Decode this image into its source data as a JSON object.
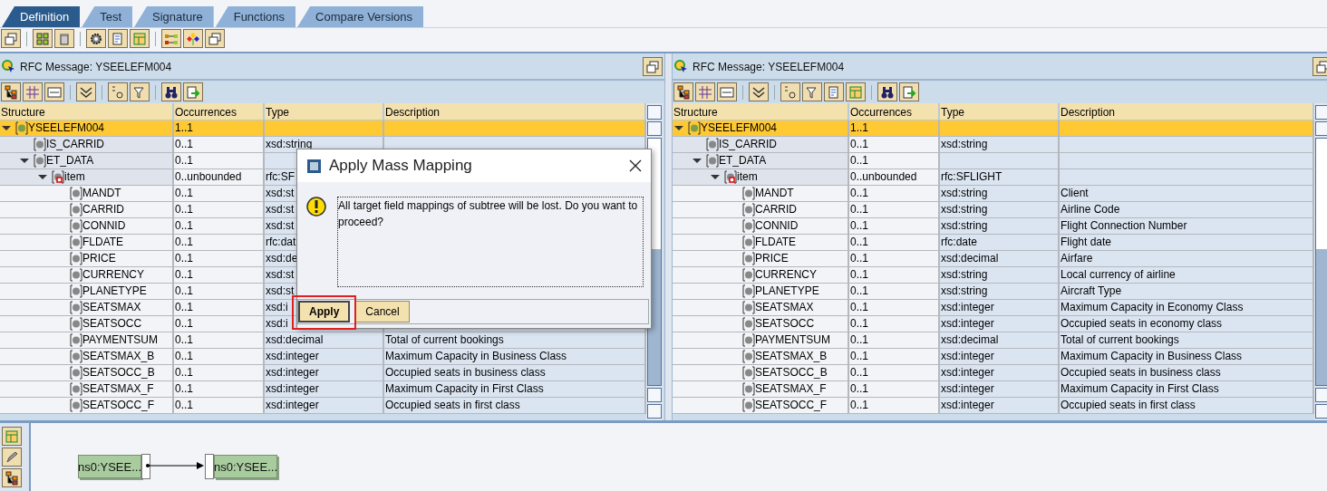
{
  "tabs": [
    {
      "label": "Definition",
      "selected": true
    },
    {
      "label": "Test",
      "selected": false
    },
    {
      "label": "Signature",
      "selected": false
    },
    {
      "label": "Functions",
      "selected": false
    },
    {
      "label": "Compare Versions",
      "selected": false
    }
  ],
  "panels": [
    {
      "title": "RFC Message: YSEELEFM004",
      "columns": [
        "Structure",
        "Occurrences",
        "Type",
        "Description"
      ],
      "tree": [
        {
          "name": "YSEELEFM004",
          "kind": "root",
          "occurrences": "1..1",
          "selected": true,
          "expanded": true,
          "children": [
            {
              "name": "IS_CARRID",
              "kind": "field",
              "occurrences": "0..1",
              "type": "xsd:string",
              "selected": false
            },
            {
              "name": "ET_DATA",
              "kind": "field",
              "occurrences": "0..1",
              "selected": false,
              "expanded": true,
              "children": [
                {
                  "name": "item",
                  "kind": "table",
                  "occurrences": "0..unbounded",
                  "type": "rfc:SF",
                  "selected": false,
                  "expanded": true,
                  "children": [
                    {
                      "name": "MANDT",
                      "kind": "field",
                      "occurrences": "0..1",
                      "type": "xsd:st",
                      "selected": false
                    },
                    {
                      "name": "CARRID",
                      "kind": "field",
                      "occurrences": "0..1",
                      "type": "xsd:st",
                      "selected": false
                    },
                    {
                      "name": "CONNID",
                      "kind": "field",
                      "occurrences": "0..1",
                      "type": "xsd:st",
                      "selected": false
                    },
                    {
                      "name": "FLDATE",
                      "kind": "field",
                      "occurrences": "0..1",
                      "type": "rfc:dat",
                      "selected": false
                    },
                    {
                      "name": "PRICE",
                      "kind": "field",
                      "occurrences": "0..1",
                      "type": "xsd:de",
                      "selected": false
                    },
                    {
                      "name": "CURRENCY",
                      "kind": "field",
                      "occurrences": "0..1",
                      "type": "xsd:st",
                      "selected": false
                    },
                    {
                      "name": "PLANETYPE",
                      "kind": "field",
                      "occurrences": "0..1",
                      "type": "xsd:st",
                      "selected": false
                    },
                    {
                      "name": "SEATSMAX",
                      "kind": "field",
                      "occurrences": "0..1",
                      "type": "xsd:i",
                      "selected": false
                    },
                    {
                      "name": "SEATSOCC",
                      "kind": "field",
                      "occurrences": "0..1",
                      "type": "xsd:i",
                      "selected": false
                    },
                    {
                      "name": "PAYMENTSUM",
                      "kind": "field",
                      "occurrences": "0..1",
                      "type": "xsd:decimal",
                      "description": "Total of current bookings",
                      "selected": false
                    },
                    {
                      "name": "SEATSMAX_B",
                      "kind": "field",
                      "occurrences": "0..1",
                      "type": "xsd:integer",
                      "description": "Maximum Capacity in Business Class",
                      "selected": false
                    },
                    {
                      "name": "SEATSOCC_B",
                      "kind": "field",
                      "occurrences": "0..1",
                      "type": "xsd:integer",
                      "description": "Occupied seats in business class",
                      "selected": false
                    },
                    {
                      "name": "SEATSMAX_F",
                      "kind": "field",
                      "occurrences": "0..1",
                      "type": "xsd:integer",
                      "description": "Maximum Capacity in First Class",
                      "selected": false
                    },
                    {
                      "name": "SEATSOCC_F",
                      "kind": "field",
                      "occurrences": "0..1",
                      "type": "xsd:integer",
                      "description": "Occupied seats in first class",
                      "selected": false
                    }
                  ]
                }
              ]
            }
          ]
        }
      ]
    },
    {
      "title": "RFC Message: YSEELEFM004",
      "columns": [
        "Structure",
        "Occurrences",
        "Type",
        "Description"
      ],
      "tree": [
        {
          "name": "YSEELEFM004",
          "kind": "root",
          "occurrences": "1..1",
          "selected": true,
          "expanded": true,
          "children": [
            {
              "name": "IS_CARRID",
              "kind": "field",
              "occurrences": "0..1",
              "type": "xsd:string",
              "selected": false
            },
            {
              "name": "ET_DATA",
              "kind": "field",
              "occurrences": "0..1",
              "selected": false,
              "expanded": true,
              "children": [
                {
                  "name": "item",
                  "kind": "table",
                  "occurrences": "0..unbounded",
                  "type": "rfc:SFLIGHT",
                  "selected": false,
                  "expanded": true,
                  "children": [
                    {
                      "name": "MANDT",
                      "kind": "field",
                      "occurrences": "0..1",
                      "type": "xsd:string",
                      "description": "Client",
                      "selected": false
                    },
                    {
                      "name": "CARRID",
                      "kind": "field",
                      "occurrences": "0..1",
                      "type": "xsd:string",
                      "description": "Airline Code",
                      "selected": false
                    },
                    {
                      "name": "CONNID",
                      "kind": "field",
                      "occurrences": "0..1",
                      "type": "xsd:string",
                      "description": "Flight Connection Number",
                      "selected": false
                    },
                    {
                      "name": "FLDATE",
                      "kind": "field",
                      "occurrences": "0..1",
                      "type": "rfc:date",
                      "description": "Flight date",
                      "selected": false
                    },
                    {
                      "name": "PRICE",
                      "kind": "field",
                      "occurrences": "0..1",
                      "type": "xsd:decimal",
                      "description": "Airfare",
                      "selected": false
                    },
                    {
                      "name": "CURRENCY",
                      "kind": "field",
                      "occurrences": "0..1",
                      "type": "xsd:string",
                      "description": "Local currency of airline",
                      "selected": false
                    },
                    {
                      "name": "PLANETYPE",
                      "kind": "field",
                      "occurrences": "0..1",
                      "type": "xsd:string",
                      "description": "Aircraft Type",
                      "selected": false
                    },
                    {
                      "name": "SEATSMAX",
                      "kind": "field",
                      "occurrences": "0..1",
                      "type": "xsd:integer",
                      "description": "Maximum Capacity in Economy Class",
                      "selected": false
                    },
                    {
                      "name": "SEATSOCC",
                      "kind": "field",
                      "occurrences": "0..1",
                      "type": "xsd:integer",
                      "description": "Occupied seats in economy class",
                      "selected": false
                    },
                    {
                      "name": "PAYMENTSUM",
                      "kind": "field",
                      "occurrences": "0..1",
                      "type": "xsd:decimal",
                      "description": "Total of current bookings",
                      "selected": false
                    },
                    {
                      "name": "SEATSMAX_B",
                      "kind": "field",
                      "occurrences": "0..1",
                      "type": "xsd:integer",
                      "description": "Maximum Capacity in Business Class",
                      "selected": false
                    },
                    {
                      "name": "SEATSOCC_B",
                      "kind": "field",
                      "occurrences": "0..1",
                      "type": "xsd:integer",
                      "description": "Occupied seats in business class",
                      "selected": false
                    },
                    {
                      "name": "SEATSMAX_F",
                      "kind": "field",
                      "occurrences": "0..1",
                      "type": "xsd:integer",
                      "description": "Maximum Capacity in First Class",
                      "selected": false
                    },
                    {
                      "name": "SEATSOCC_F",
                      "kind": "field",
                      "occurrences": "0..1",
                      "type": "xsd:integer",
                      "description": "Occupied seats in first class",
                      "selected": false
                    }
                  ]
                }
              ]
            }
          ]
        }
      ]
    }
  ],
  "dialog": {
    "title": "Apply Mass Mapping",
    "message": "All target field mappings of subtree will be lost. Do you want to proceed?",
    "buttons": [
      {
        "label": "Apply",
        "default": true,
        "highlighted": true
      },
      {
        "label": "Cancel",
        "default": false,
        "highlighted": false
      }
    ]
  },
  "mapping": {
    "source": "ns0:YSEE...",
    "target": "ns0:YSEE..."
  }
}
